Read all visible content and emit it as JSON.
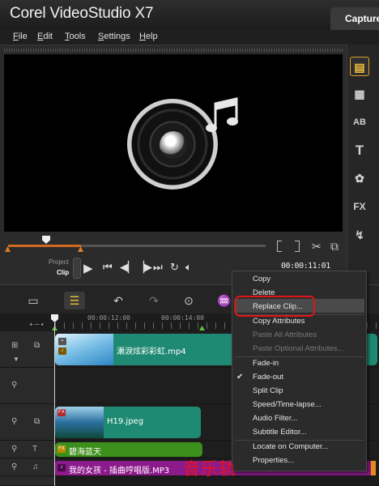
{
  "app": {
    "title": "Corel VideoStudio X7",
    "capture_tab": "Capture"
  },
  "menu": [
    {
      "label": "File",
      "u": "F",
      "rest": "ile"
    },
    {
      "label": "Edit",
      "u": "E",
      "rest": "dit"
    },
    {
      "label": "Tools",
      "u": "T",
      "rest": "ools"
    },
    {
      "label": "Settings",
      "u": "S",
      "rest": "ettings"
    },
    {
      "label": "Help",
      "u": "H",
      "rest": "elp"
    }
  ],
  "player": {
    "mode_project": "Project",
    "mode_clip": "Clip",
    "timecode": "00:00:11:01",
    "icons": [
      "play-icon",
      "home-icon",
      "prev-frame-icon",
      "next-frame-icon",
      "end-icon",
      "repeat-icon",
      "volume-icon"
    ],
    "mark_in_icon": "mark-in-icon",
    "mark_out_icon": "mark-out-icon",
    "split_icon": "scissors-icon",
    "expand_icon": "enlarge-icon"
  },
  "library_icons": [
    "media-icon",
    "instant-project-icon",
    "transition-icon",
    "title-icon",
    "graphic-icon",
    "fx-icon",
    "path-icon"
  ],
  "ruler": {
    "t1": "00:00:12:00",
    "t2": "00:00:14:00"
  },
  "tracks": {
    "video_clip": "瀨淚炫彩彩虹.mp4",
    "overlay_clip": "H19.jpeg",
    "title_clip": "碧海蓝天",
    "music_clip": "我的女孩 - 插曲哼唱版.MP3"
  },
  "context_menu": {
    "items": [
      {
        "label": "Copy",
        "enabled": true
      },
      {
        "label": "Delete",
        "enabled": true
      },
      {
        "label": "Replace Clip...",
        "enabled": true,
        "highlighted": true
      },
      {
        "label": "Copy Attributes",
        "enabled": true
      },
      {
        "label": "Paste All Attributes",
        "enabled": false
      },
      {
        "label": "Paste Optional Attributes...",
        "enabled": false
      },
      {
        "label": "Fade-in",
        "enabled": true
      },
      {
        "label": "Fade-out",
        "enabled": true,
        "checked": true
      },
      {
        "label": "Split Clip",
        "enabled": true
      },
      {
        "label": "Speed/Time-lapse...",
        "enabled": true
      },
      {
        "label": "Audio Filter...",
        "enabled": true
      },
      {
        "label": "Subtitle Editor...",
        "enabled": true
      },
      {
        "label": "Locate on Computer...",
        "enabled": true
      },
      {
        "label": "Properties...",
        "enabled": true
      }
    ]
  },
  "annotation": "音乐轨",
  "colors": {
    "accent": "#f4c430",
    "clip_teal": "#1f8a73",
    "music_purple": "#8b1a8b",
    "title_green": "#3c8f1a",
    "highlight_red": "#e21414"
  }
}
